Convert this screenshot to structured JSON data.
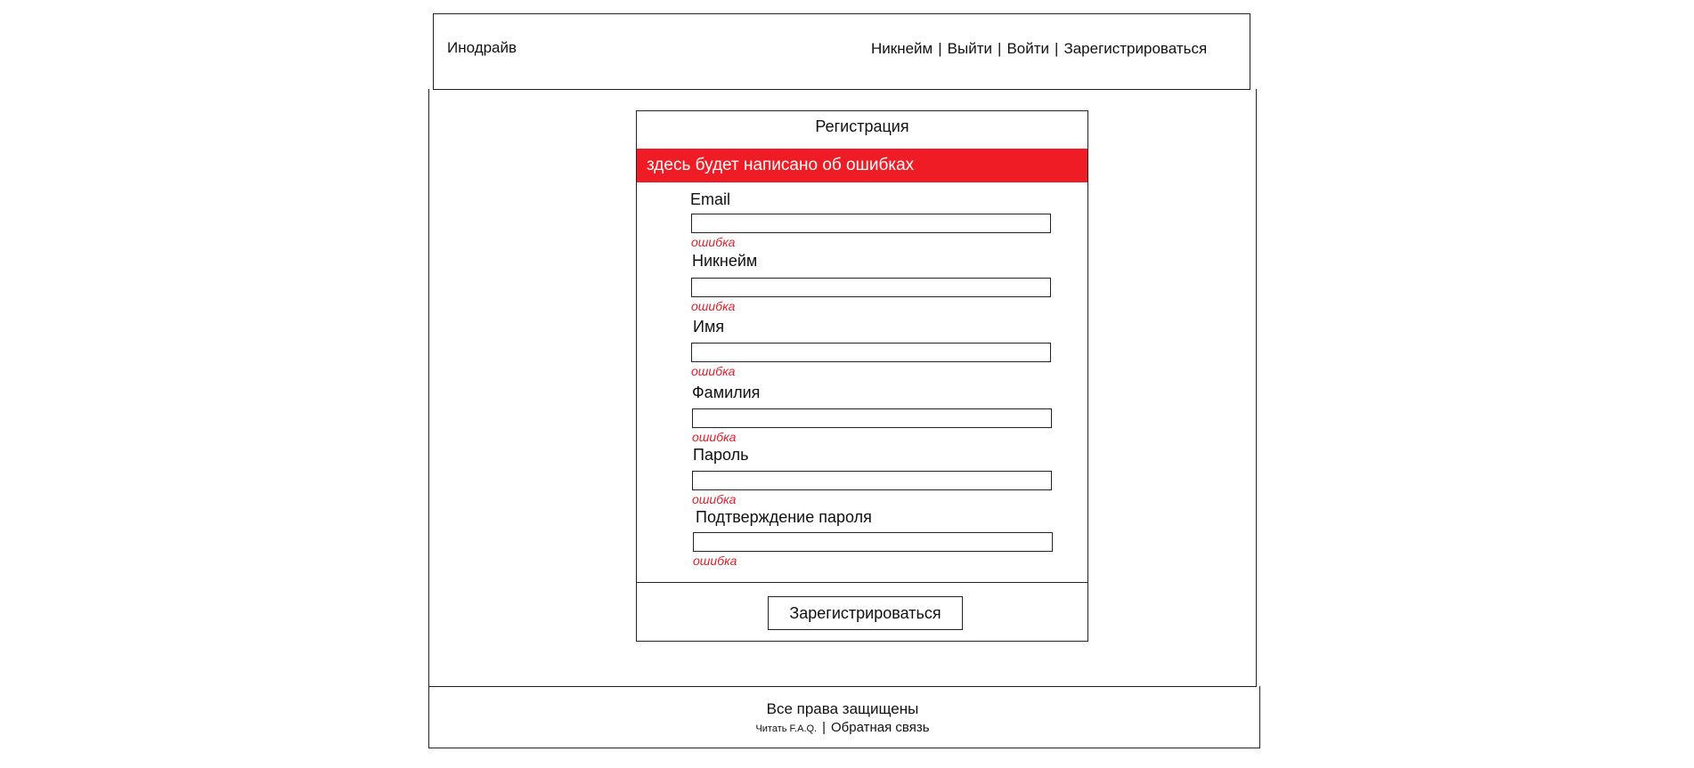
{
  "header": {
    "logo": "Инодрайв",
    "nav": {
      "nickname": "Никнейм",
      "logout": "Выйти",
      "login": "Войти",
      "register": "Зарегистрироваться",
      "separator": "|"
    }
  },
  "form": {
    "title": "Регистрация",
    "error_banner": "здесь будет написано об ошибках",
    "fields": [
      {
        "label": "Email",
        "value": "",
        "error": "ошибка"
      },
      {
        "label": "Никнейм",
        "value": "",
        "error": "ошибка"
      },
      {
        "label": "Имя",
        "value": "",
        "error": "ошибка"
      },
      {
        "label": "Фамилия",
        "value": "",
        "error": "ошибка"
      },
      {
        "label": "Пароль",
        "value": "",
        "error": "ошибка"
      },
      {
        "label": "Подтверждение пароля",
        "value": "",
        "error": "ошибка"
      }
    ],
    "submit_label": "Зарегистрироваться"
  },
  "footer": {
    "copyright": "Все права защищены",
    "faq": "Читать F.A.Q.",
    "separator": "|",
    "feedback": "Обратная связь"
  },
  "colors": {
    "error_banner_bg": "#f01c25",
    "error_text": "#e0202a"
  }
}
